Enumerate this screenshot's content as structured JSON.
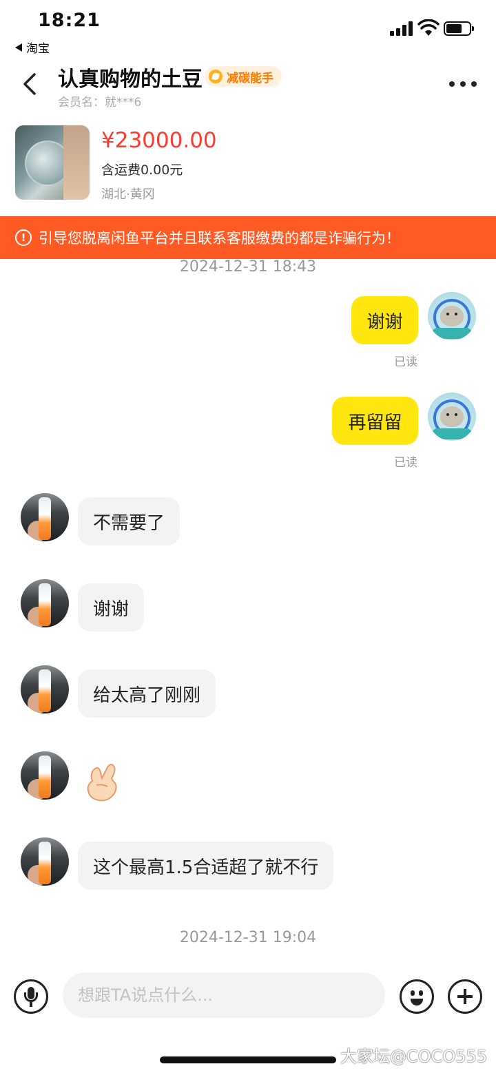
{
  "status_bar": {
    "time": "18:21",
    "back_app": "淘宝"
  },
  "header": {
    "title": "认真购物的土豆",
    "badge": "减碳能手",
    "member": "会员名：就***6"
  },
  "product": {
    "price": "¥23000.00",
    "shipping": "含运费0.00元",
    "location": "湖北·黄冈"
  },
  "warning": {
    "text": "引导您脱离闲鱼平台并且联系客服缴费的都是诈骗行为！"
  },
  "chat": {
    "timestamp_1": "2024-12-31 18:43",
    "messages": [
      {
        "from": "me",
        "text": "谢谢",
        "status": "已读"
      },
      {
        "from": "me",
        "text": "再留留",
        "status": "已读"
      },
      {
        "from": "other",
        "text": "不需要了"
      },
      {
        "from": "other",
        "text": "谢谢"
      },
      {
        "from": "other",
        "text": "给太高了刚刚"
      },
      {
        "from": "other",
        "emoji": "finger-heart"
      },
      {
        "from": "other",
        "text": "这个最高1.5合适超了就不行"
      }
    ],
    "timestamp_2": "2024-12-31 19:04"
  },
  "input": {
    "placeholder": "想跟TA说点什么..."
  },
  "watermark": "大家坛@COCO555",
  "colors": {
    "accent_yellow": "#ffe60f",
    "warning_orange": "#ff5a24",
    "price_red": "#ff3b30"
  }
}
